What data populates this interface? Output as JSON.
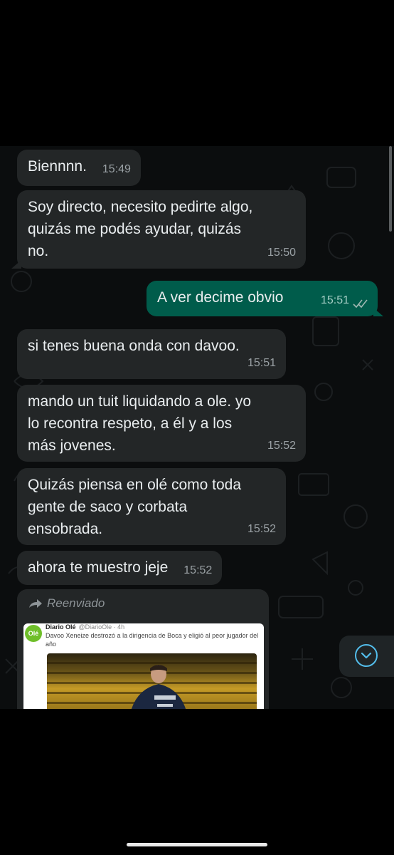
{
  "messages": [
    {
      "direction": "in",
      "text": "Biennnn.",
      "time": "15:49"
    },
    {
      "direction": "in",
      "lines": [
        "Soy directo, necesito pedirte algo,",
        "quizás me podés ayudar, quizás",
        "no."
      ],
      "time": "15:50"
    },
    {
      "direction": "out",
      "text": "A ver decime obvio",
      "time": "15:51",
      "status": "read"
    },
    {
      "direction": "in",
      "text": "si tenes buena onda con davoo.",
      "time": "15:51"
    },
    {
      "direction": "in",
      "lines": [
        "mando un tuit liquidando a ole. yo",
        "lo recontra respeto, a él y a los",
        "más jovenes."
      ],
      "time": "15:52"
    },
    {
      "direction": "in",
      "lines": [
        "Quizás piensa en olé como toda",
        "gente de saco y corbata",
        "ensobrada."
      ],
      "time": "15:52"
    },
    {
      "direction": "in",
      "text": "ahora te muestro jeje",
      "time": "15:52"
    }
  ],
  "forwarded": {
    "label": "Reenviado",
    "tweet": {
      "logo": "Olé",
      "author": "Diario Olé",
      "handle": "@DiarioOle · 4h",
      "text": "Davoo Xeneize destrozó a la dirigencia de Boca y eligió al peor jugador del año"
    }
  },
  "colors": {
    "incoming_bubble": "#232627",
    "outgoing_bubble": "#005c4b",
    "read_ticks": "#53bdeb",
    "background": "#0b0d0e"
  },
  "icons": [
    "forward-arrow-icon",
    "double-check-icon",
    "chevron-down-icon"
  ]
}
